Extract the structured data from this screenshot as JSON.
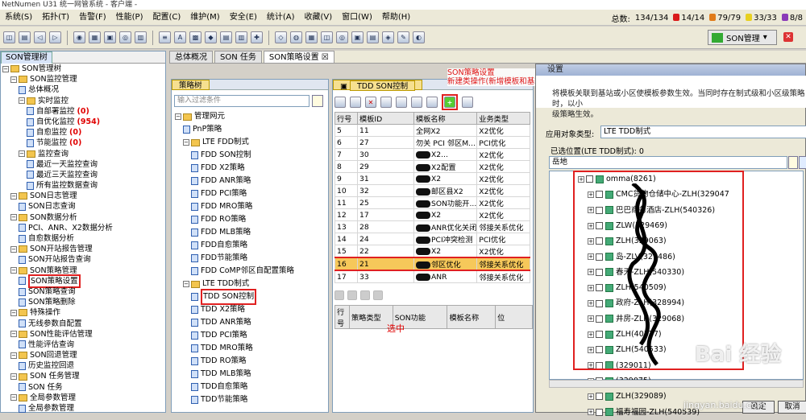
{
  "app": {
    "title": "NetNumen U31 统一网管系统 - 客户端 -"
  },
  "menu": [
    "系统(S)",
    "拓扑(T)",
    "告警(F)",
    "性能(P)",
    "配置(C)",
    "维护(M)",
    "安全(E)",
    "统计(A)",
    "收藏(V)",
    "窗口(W)",
    "帮助(H)"
  ],
  "stats": {
    "total_label": "总数:",
    "total": "134/134",
    "red": "14/14",
    "orange": "79/79",
    "yellow": "33/33",
    "purple": "8/8",
    "colors": {
      "red": "#d91a1a",
      "orange": "#e07b1a",
      "yellow": "#e8d020",
      "purple": "#8a3ab8"
    }
  },
  "toolbar": {
    "son_button": "SON管理"
  },
  "left": {
    "tab": "SON管理树",
    "items": [
      {
        "d": 0,
        "t": "SON管理树",
        "f": 1
      },
      {
        "d": 1,
        "t": "SON监控管理",
        "f": 1
      },
      {
        "d": 2,
        "t": "总体概况",
        "f": 0
      },
      {
        "d": 2,
        "t": "实时监控",
        "f": 1
      },
      {
        "d": 3,
        "t": "自部署监控",
        "f": 0,
        "c": "(0)"
      },
      {
        "d": 3,
        "t": "自优化监控",
        "f": 0,
        "c": "(954)"
      },
      {
        "d": 3,
        "t": "自愈监控",
        "f": 0,
        "c": "(0)"
      },
      {
        "d": 3,
        "t": "节能监控",
        "f": 0,
        "c": "(0)"
      },
      {
        "d": 2,
        "t": "监控查询",
        "f": 1
      },
      {
        "d": 3,
        "t": "最近一天监控查询",
        "f": 0
      },
      {
        "d": 3,
        "t": "最近三天监控查询",
        "f": 0
      },
      {
        "d": 3,
        "t": "所有监控数据查询",
        "f": 0
      },
      {
        "d": 1,
        "t": "SON日志管理",
        "f": 1
      },
      {
        "d": 2,
        "t": "SON日志查询",
        "f": 0
      },
      {
        "d": 1,
        "t": "SON数据分析",
        "f": 1
      },
      {
        "d": 2,
        "t": "PCI、ANR、X2数据分析",
        "f": 0
      },
      {
        "d": 2,
        "t": "自愈数据分析",
        "f": 0
      },
      {
        "d": 1,
        "t": "SON开站报告管理",
        "f": 1
      },
      {
        "d": 2,
        "t": "SON开站报告查询",
        "f": 0
      },
      {
        "d": 1,
        "t": "SON策略管理",
        "f": 1
      },
      {
        "d": 2,
        "t": "SON策略设置",
        "f": 0,
        "h": 1
      },
      {
        "d": 2,
        "t": "SON策略查询",
        "f": 0
      },
      {
        "d": 2,
        "t": "SON策略删除",
        "f": 0
      },
      {
        "d": 1,
        "t": "特殊操作",
        "f": 1
      },
      {
        "d": 2,
        "t": "无线参数自配置",
        "f": 0
      },
      {
        "d": 1,
        "t": "SON性能评估管理",
        "f": 1
      },
      {
        "d": 2,
        "t": "性能评估查询",
        "f": 0
      },
      {
        "d": 1,
        "t": "SON回退管理",
        "f": 1
      },
      {
        "d": 2,
        "t": "历史监控回退",
        "f": 0
      },
      {
        "d": 1,
        "t": "SON 任务管理",
        "f": 1
      },
      {
        "d": 2,
        "t": "SON 任务",
        "f": 0
      },
      {
        "d": 1,
        "t": "全局参数管理",
        "f": 1
      },
      {
        "d": 2,
        "t": "全局参数管理",
        "f": 0
      }
    ]
  },
  "tabs": [
    "总体概况",
    "SON 任务",
    "SON策略设置"
  ],
  "strategy": {
    "header": "策略树",
    "filter_placeholder": "输入过滤条件",
    "items": [
      {
        "d": 0,
        "t": "管理网元",
        "f": 1
      },
      {
        "d": 1,
        "t": "PnP策略",
        "f": 0
      },
      {
        "d": 1,
        "t": "LTE FDD制式",
        "f": 1
      },
      {
        "d": 2,
        "t": "FDD SON控制",
        "f": 0
      },
      {
        "d": 2,
        "t": "FDD X2策略",
        "f": 0
      },
      {
        "d": 2,
        "t": "FDD ANR策略",
        "f": 0
      },
      {
        "d": 2,
        "t": "FDD PCI策略",
        "f": 0
      },
      {
        "d": 2,
        "t": "FDD MRO策略",
        "f": 0
      },
      {
        "d": 2,
        "t": "FDD RO策略",
        "f": 0
      },
      {
        "d": 2,
        "t": "FDD MLB策略",
        "f": 0
      },
      {
        "d": 2,
        "t": "FDD自愈策略",
        "f": 0
      },
      {
        "d": 2,
        "t": "FDD节能策略",
        "f": 0
      },
      {
        "d": 2,
        "t": "FDD CoMP邻区自配置策略",
        "f": 0
      },
      {
        "d": 1,
        "t": "LTE TDD制式",
        "f": 1
      },
      {
        "d": 2,
        "t": "TDD SON控制",
        "f": 0,
        "h": 1
      },
      {
        "d": 2,
        "t": "TDD X2策略",
        "f": 0
      },
      {
        "d": 2,
        "t": "TDD ANR策略",
        "f": 0
      },
      {
        "d": 2,
        "t": "TDD PCI策略",
        "f": 0
      },
      {
        "d": 2,
        "t": "TDD MRO策略",
        "f": 0
      },
      {
        "d": 2,
        "t": "TDD RO策略",
        "f": 0
      },
      {
        "d": 2,
        "t": "TDD MLB策略",
        "f": 0
      },
      {
        "d": 2,
        "t": "TDD自愈策略",
        "f": 0
      },
      {
        "d": 2,
        "t": "TDD节能策略",
        "f": 0
      }
    ]
  },
  "tdd": {
    "header": "TDD SON控制",
    "cols": [
      "行号",
      "模板ID",
      "模板名称",
      "业务类型"
    ],
    "rows": [
      [
        "5",
        "11",
        "全网X2",
        "X2优化",
        0
      ],
      [
        "6",
        "27",
        "勿关 PCI 邻区M...",
        "PCI优化",
        0
      ],
      [
        "7",
        "30",
        "X2...",
        "X2优化",
        1
      ],
      [
        "8",
        "29",
        "X2配置",
        "X2优化",
        1
      ],
      [
        "9",
        "31",
        "X2",
        "X2优化",
        1
      ],
      [
        "10",
        "32",
        "邮区县X2",
        "X2优化",
        1
      ],
      [
        "11",
        "25",
        "SON功能开...",
        "X2优化",
        1
      ],
      [
        "12",
        "17",
        "X2",
        "X2优化",
        1
      ],
      [
        "13",
        "28",
        "ANR优化关闭",
        "邻接关系优化",
        1
      ],
      [
        "14",
        "24",
        "PCI冲突检测",
        "PCI优化",
        1
      ],
      [
        "15",
        "22",
        "X2",
        "X2优化",
        1
      ],
      [
        "16",
        "21",
        "邻区优化",
        "邻接关系优化",
        1,
        "sel"
      ],
      [
        "17",
        "33",
        "ANR",
        "邻接关系优化",
        1
      ]
    ],
    "lower_cols": [
      "行号",
      "策略类型",
      "SON功能",
      "模板名称",
      "位"
    ]
  },
  "annotations": {
    "selected": "选中",
    "add_note": "SON策略设置\n新建类操作(新增模板和基站关联)"
  },
  "dialog": {
    "title": "设置",
    "desc1": "将模板关联到基站或小区使模板参数生效。当同时存在制式级和小区级策略时，以小",
    "desc2": "级策略生效。",
    "type_label": "应用对象类型:",
    "type_value": "LTE TDD制式",
    "selected_label": "已选位置(LTE TDD制式):  0",
    "search_value": "岳地",
    "cells": [
      "omma(8261)",
      "CMC货物仓储中心-ZLH(329047",
      "巴巴商务酒店-ZLH(540326)",
      "ZLW(329469)",
      "ZLH(329063)",
      "岛-ZLV(329486)",
      "春天-ZLH(540330)",
      "ZLH(540509)",
      "政府-ZLH(328994)",
      "井房-ZLH(329068)",
      "ZLH(40377)",
      "ZLH(540533)",
      "(329011)",
      "(329075)",
      "ZLH(329089)",
      "福寿福园-ZLH(540539)"
    ],
    "ok": "确定",
    "cancel": "取消"
  },
  "watermark": {
    "main": "Bai 经验",
    "url": "jingyan.baidu.com"
  }
}
